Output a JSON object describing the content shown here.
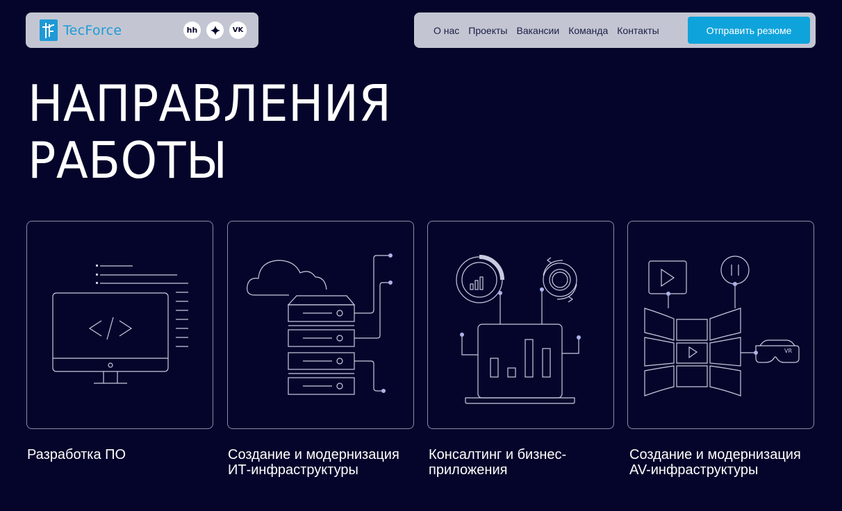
{
  "brand": {
    "logo_text": "TecForce",
    "accent_color": "#1e9ad6",
    "socials": [
      {
        "label": "hh",
        "icon": "hh-icon"
      },
      {
        "label": "✦",
        "icon": "sparkle-icon"
      },
      {
        "label": "vk",
        "icon": "vk-icon"
      }
    ]
  },
  "nav": {
    "links": [
      "О нас",
      "Проекты",
      "Вакансии",
      "Команда",
      "Контакты"
    ],
    "cta_label": "Отправить резюме",
    "cta_color": "#0fa3dc"
  },
  "hero": {
    "title_line1": "НАПРАВЛЕНИЯ",
    "title_line2": "РАБОТЫ"
  },
  "directions": [
    {
      "label_line1": "Разработка ПО",
      "label_line2": "",
      "icon": "monitor-code-icon"
    },
    {
      "label_line1": "Создание и модернизация",
      "label_line2": "ИТ-инфраструктуры",
      "icon": "cloud-server-icon"
    },
    {
      "label_line1": "Консалтинг и бизнес-",
      "label_line2": "приложения",
      "icon": "laptop-analytics-icon"
    },
    {
      "label_line1": "Создание и модернизация",
      "label_line2": "AV-инфраструктуры",
      "icon": "video-wall-vr-icon"
    }
  ],
  "colors": {
    "background": "#05052b",
    "line": "#c9cbe0",
    "dot": "#aeb2ea"
  }
}
